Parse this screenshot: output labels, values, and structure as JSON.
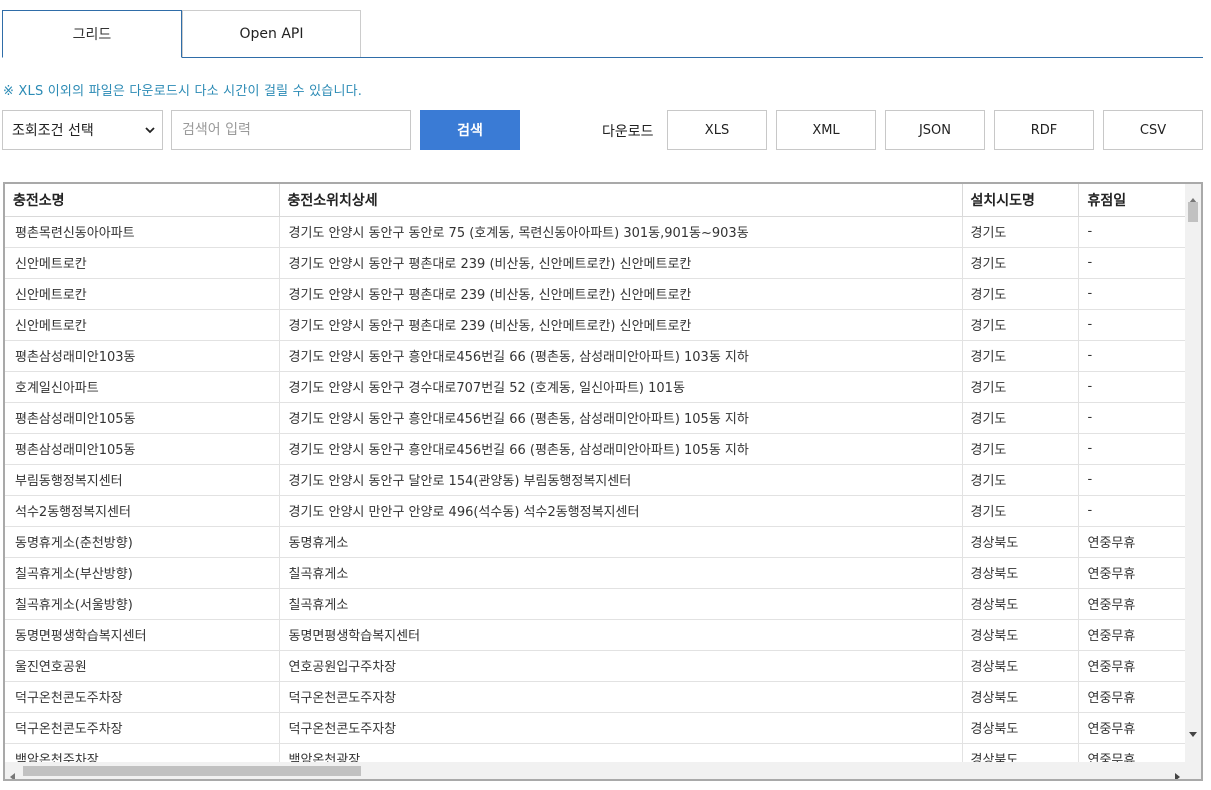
{
  "tabs": [
    {
      "label": "그리드",
      "active": true
    },
    {
      "label": "Open API",
      "active": false
    }
  ],
  "notice": "※ XLS 이외의 파일은 다운로드시 다소 시간이 걸릴 수 있습니다.",
  "search": {
    "condition_selected": "조회조건 선택",
    "placeholder": "검색어 입력",
    "button_label": "검색"
  },
  "download": {
    "label": "다운로드",
    "formats": [
      "XLS",
      "XML",
      "JSON",
      "RDF",
      "CSV"
    ]
  },
  "colors": {
    "accent": "#3a7bd5",
    "tab_border": "#2f6da8",
    "notice": "#2c8bb5"
  },
  "grid": {
    "columns": [
      "충전소명",
      "충전소위치상세",
      "설치시도명",
      "휴점일"
    ],
    "rows": [
      [
        "평촌목련신동아아파트",
        "경기도 안양시 동안구 동안로 75 (호계동, 목련신동아아파트) 301동,901동~903동",
        "경기도",
        "-"
      ],
      [
        "신안메트로칸",
        "경기도 안양시 동안구 평촌대로 239 (비산동, 신안메트로칸) 신안메트로칸",
        "경기도",
        "-"
      ],
      [
        "신안메트로칸",
        "경기도 안양시 동안구 평촌대로 239 (비산동, 신안메트로칸) 신안메트로칸",
        "경기도",
        "-"
      ],
      [
        "신안메트로칸",
        "경기도 안양시 동안구 평촌대로 239 (비산동, 신안메트로칸) 신안메트로칸",
        "경기도",
        "-"
      ],
      [
        "평촌삼성래미안103동",
        "경기도 안양시 동안구 흥안대로456번길 66 (평촌동, 삼성래미안아파트) 103동 지하",
        "경기도",
        "-"
      ],
      [
        "호계일신아파트",
        "경기도 안양시 동안구 경수대로707번길 52 (호계동, 일신아파트) 101동",
        "경기도",
        "-"
      ],
      [
        "평촌삼성래미안105동",
        "경기도 안양시 동안구 흥안대로456번길 66 (평촌동, 삼성래미안아파트) 105동 지하",
        "경기도",
        "-"
      ],
      [
        "평촌삼성래미안105동",
        "경기도 안양시 동안구 흥안대로456번길 66 (평촌동, 삼성래미안아파트) 105동 지하",
        "경기도",
        "-"
      ],
      [
        "부림동행정복지센터",
        "경기도 안양시 동안구 달안로 154(관양동) 부림동행정복지센터",
        "경기도",
        "-"
      ],
      [
        "석수2동행정복지센터",
        "경기도 안양시 만안구 안양로 496(석수동) 석수2동행정복지센터",
        "경기도",
        "-"
      ],
      [
        "동명휴게소(춘천방향)",
        "동명휴게소",
        "경상북도",
        "연중무휴"
      ],
      [
        "칠곡휴게소(부산방향)",
        "칠곡휴게소",
        "경상북도",
        "연중무휴"
      ],
      [
        "칠곡휴게소(서울방향)",
        "칠곡휴게소",
        "경상북도",
        "연중무휴"
      ],
      [
        "동명면평생학습복지센터",
        "동명면평생학습복지센터",
        "경상북도",
        "연중무휴"
      ],
      [
        "울진연호공원",
        "연호공원입구주차장",
        "경상북도",
        "연중무휴"
      ],
      [
        "덕구온천콘도주차장",
        "덕구온천콘도주자창",
        "경상북도",
        "연중무휴"
      ],
      [
        "덕구온천콘도주차장",
        "덕구온천콘도주자창",
        "경상북도",
        "연중무휴"
      ],
      [
        "백암온천주차장",
        "백암온천광장",
        "경상북도",
        "연중무휴"
      ]
    ]
  }
}
